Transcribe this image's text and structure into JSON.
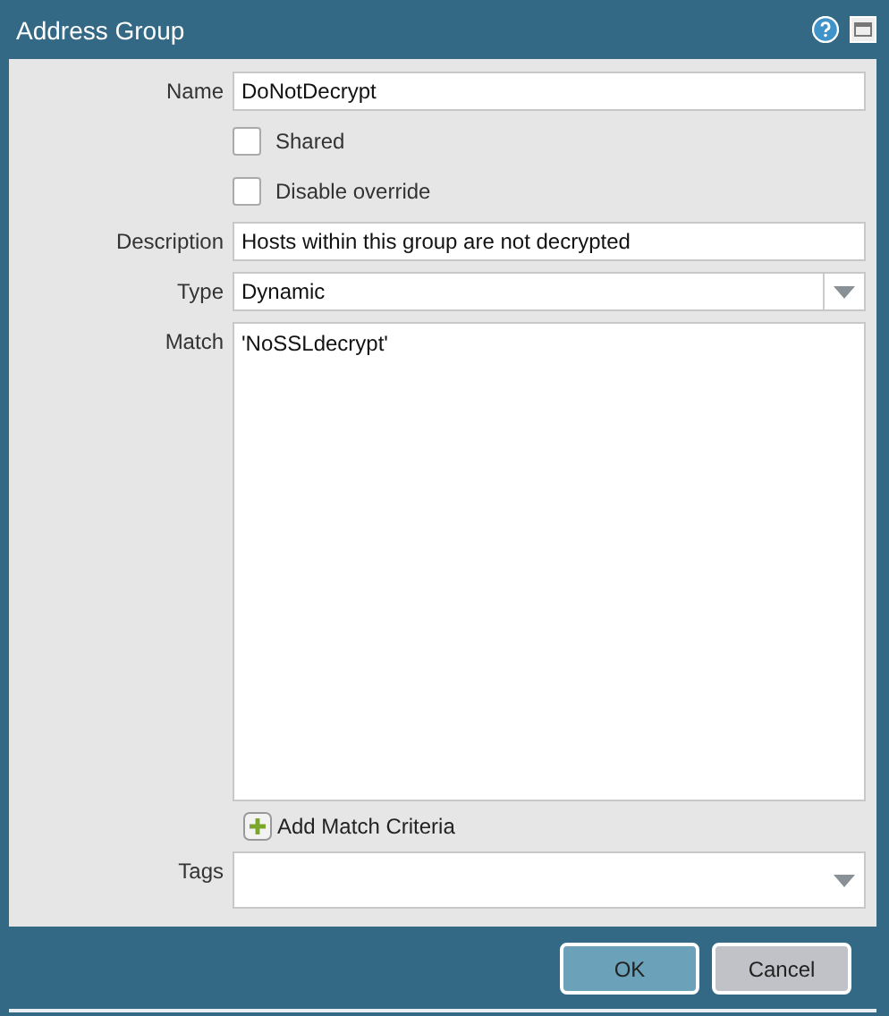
{
  "window": {
    "title": "Address Group"
  },
  "form": {
    "name": {
      "label": "Name",
      "value": "DoNotDecrypt"
    },
    "checkboxes": [
      {
        "label": "Shared",
        "checked": false
      },
      {
        "label": "Disable override",
        "checked": false
      }
    ],
    "description": {
      "label": "Description",
      "value": "Hosts within this group are not decrypted"
    },
    "type": {
      "label": "Type",
      "value": "Dynamic"
    },
    "match": {
      "label": "Match",
      "value": "'NoSSLdecrypt'"
    },
    "add_match_criteria": "Add Match Criteria",
    "tags": {
      "label": "Tags"
    }
  },
  "buttons": [
    {
      "label": "OK",
      "kind": "primary"
    },
    {
      "label": "Cancel",
      "kind": "secondary"
    }
  ]
}
